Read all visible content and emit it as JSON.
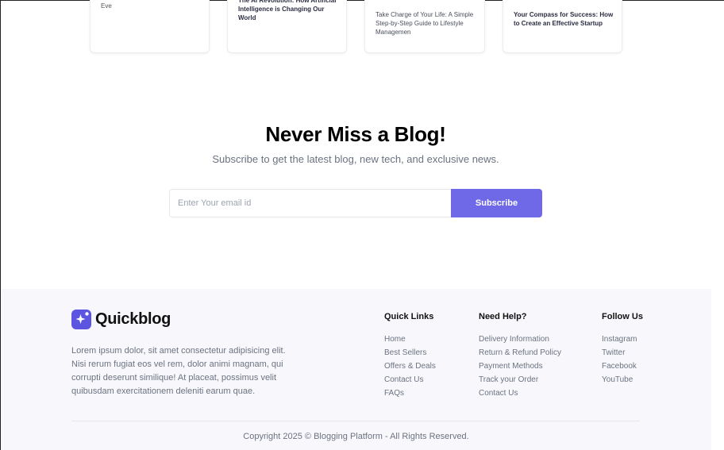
{
  "cards": [
    {
      "text": "Eve"
    },
    {
      "text": "The AI Revolution: How Artificial Intelligence is Changing Our World"
    },
    {
      "text": "Take Charge of Your Life: A Simple Step-by-Step Guide to Lifestyle Managemen"
    },
    {
      "text": "Your Compass for Success: How to Create an Effective Startup"
    }
  ],
  "newsletter": {
    "title": "Never Miss a Blog!",
    "subtitle": "Subscribe to get the latest blog, new tech, and exclusive news.",
    "email_placeholder": "Enter Your email id",
    "subscribe_label": "Subscribe"
  },
  "footer": {
    "logo_icon": "sparkle-logo-icon",
    "brand": "Quickblog",
    "about": "Lorem ipsum dolor, sit amet consectetur adipisicing elit. Nisi rerum fugiat eos vel rem, dolor animi magnam, qui corrupti deserunt similique! At placeat, possimus velit quibusdam exercitationem deleniti earum quae.",
    "quick_links": {
      "title": "Quick Links",
      "items": [
        "Home",
        "Best Sellers",
        "Offers & Deals",
        "Contact Us",
        "FAQs"
      ]
    },
    "need_help": {
      "title": "Need Help?",
      "items": [
        "Delivery Information",
        "Return & Refund Policy",
        "Payment Methods",
        "Track your Order",
        "Contact Us"
      ]
    },
    "follow_us": {
      "title": "Follow Us",
      "items": [
        "Instagram",
        "Twitter",
        "Facebook",
        "YouTube"
      ]
    },
    "copyright": "Copyright 2025 © Blogging Platform - All Rights Reserved."
  },
  "colors": {
    "accent": "#6f69e8",
    "footer_bg": "#f8f8fc",
    "muted_text": "#6b7280"
  }
}
